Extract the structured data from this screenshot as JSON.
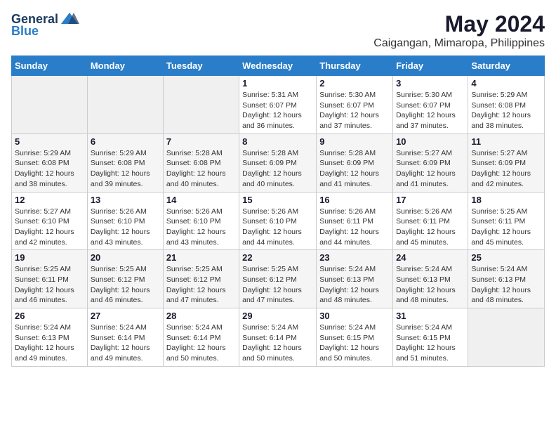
{
  "logo": {
    "general": "General",
    "blue": "Blue"
  },
  "title": "May 2024",
  "location": "Caigangan, Mimaropa, Philippines",
  "headers": [
    "Sunday",
    "Monday",
    "Tuesday",
    "Wednesday",
    "Thursday",
    "Friday",
    "Saturday"
  ],
  "weeks": [
    [
      {
        "day": "",
        "info": ""
      },
      {
        "day": "",
        "info": ""
      },
      {
        "day": "",
        "info": ""
      },
      {
        "day": "1",
        "info": "Sunrise: 5:31 AM\nSunset: 6:07 PM\nDaylight: 12 hours and 36 minutes."
      },
      {
        "day": "2",
        "info": "Sunrise: 5:30 AM\nSunset: 6:07 PM\nDaylight: 12 hours and 37 minutes."
      },
      {
        "day": "3",
        "info": "Sunrise: 5:30 AM\nSunset: 6:07 PM\nDaylight: 12 hours and 37 minutes."
      },
      {
        "day": "4",
        "info": "Sunrise: 5:29 AM\nSunset: 6:08 PM\nDaylight: 12 hours and 38 minutes."
      }
    ],
    [
      {
        "day": "5",
        "info": "Sunrise: 5:29 AM\nSunset: 6:08 PM\nDaylight: 12 hours and 38 minutes."
      },
      {
        "day": "6",
        "info": "Sunrise: 5:29 AM\nSunset: 6:08 PM\nDaylight: 12 hours and 39 minutes."
      },
      {
        "day": "7",
        "info": "Sunrise: 5:28 AM\nSunset: 6:08 PM\nDaylight: 12 hours and 40 minutes."
      },
      {
        "day": "8",
        "info": "Sunrise: 5:28 AM\nSunset: 6:09 PM\nDaylight: 12 hours and 40 minutes."
      },
      {
        "day": "9",
        "info": "Sunrise: 5:28 AM\nSunset: 6:09 PM\nDaylight: 12 hours and 41 minutes."
      },
      {
        "day": "10",
        "info": "Sunrise: 5:27 AM\nSunset: 6:09 PM\nDaylight: 12 hours and 41 minutes."
      },
      {
        "day": "11",
        "info": "Sunrise: 5:27 AM\nSunset: 6:09 PM\nDaylight: 12 hours and 42 minutes."
      }
    ],
    [
      {
        "day": "12",
        "info": "Sunrise: 5:27 AM\nSunset: 6:10 PM\nDaylight: 12 hours and 42 minutes."
      },
      {
        "day": "13",
        "info": "Sunrise: 5:26 AM\nSunset: 6:10 PM\nDaylight: 12 hours and 43 minutes."
      },
      {
        "day": "14",
        "info": "Sunrise: 5:26 AM\nSunset: 6:10 PM\nDaylight: 12 hours and 43 minutes."
      },
      {
        "day": "15",
        "info": "Sunrise: 5:26 AM\nSunset: 6:10 PM\nDaylight: 12 hours and 44 minutes."
      },
      {
        "day": "16",
        "info": "Sunrise: 5:26 AM\nSunset: 6:11 PM\nDaylight: 12 hours and 44 minutes."
      },
      {
        "day": "17",
        "info": "Sunrise: 5:26 AM\nSunset: 6:11 PM\nDaylight: 12 hours and 45 minutes."
      },
      {
        "day": "18",
        "info": "Sunrise: 5:25 AM\nSunset: 6:11 PM\nDaylight: 12 hours and 45 minutes."
      }
    ],
    [
      {
        "day": "19",
        "info": "Sunrise: 5:25 AM\nSunset: 6:11 PM\nDaylight: 12 hours and 46 minutes."
      },
      {
        "day": "20",
        "info": "Sunrise: 5:25 AM\nSunset: 6:12 PM\nDaylight: 12 hours and 46 minutes."
      },
      {
        "day": "21",
        "info": "Sunrise: 5:25 AM\nSunset: 6:12 PM\nDaylight: 12 hours and 47 minutes."
      },
      {
        "day": "22",
        "info": "Sunrise: 5:25 AM\nSunset: 6:12 PM\nDaylight: 12 hours and 47 minutes."
      },
      {
        "day": "23",
        "info": "Sunrise: 5:24 AM\nSunset: 6:13 PM\nDaylight: 12 hours and 48 minutes."
      },
      {
        "day": "24",
        "info": "Sunrise: 5:24 AM\nSunset: 6:13 PM\nDaylight: 12 hours and 48 minutes."
      },
      {
        "day": "25",
        "info": "Sunrise: 5:24 AM\nSunset: 6:13 PM\nDaylight: 12 hours and 48 minutes."
      }
    ],
    [
      {
        "day": "26",
        "info": "Sunrise: 5:24 AM\nSunset: 6:13 PM\nDaylight: 12 hours and 49 minutes."
      },
      {
        "day": "27",
        "info": "Sunrise: 5:24 AM\nSunset: 6:14 PM\nDaylight: 12 hours and 49 minutes."
      },
      {
        "day": "28",
        "info": "Sunrise: 5:24 AM\nSunset: 6:14 PM\nDaylight: 12 hours and 50 minutes."
      },
      {
        "day": "29",
        "info": "Sunrise: 5:24 AM\nSunset: 6:14 PM\nDaylight: 12 hours and 50 minutes."
      },
      {
        "day": "30",
        "info": "Sunrise: 5:24 AM\nSunset: 6:15 PM\nDaylight: 12 hours and 50 minutes."
      },
      {
        "day": "31",
        "info": "Sunrise: 5:24 AM\nSunset: 6:15 PM\nDaylight: 12 hours and 51 minutes."
      },
      {
        "day": "",
        "info": ""
      }
    ]
  ]
}
